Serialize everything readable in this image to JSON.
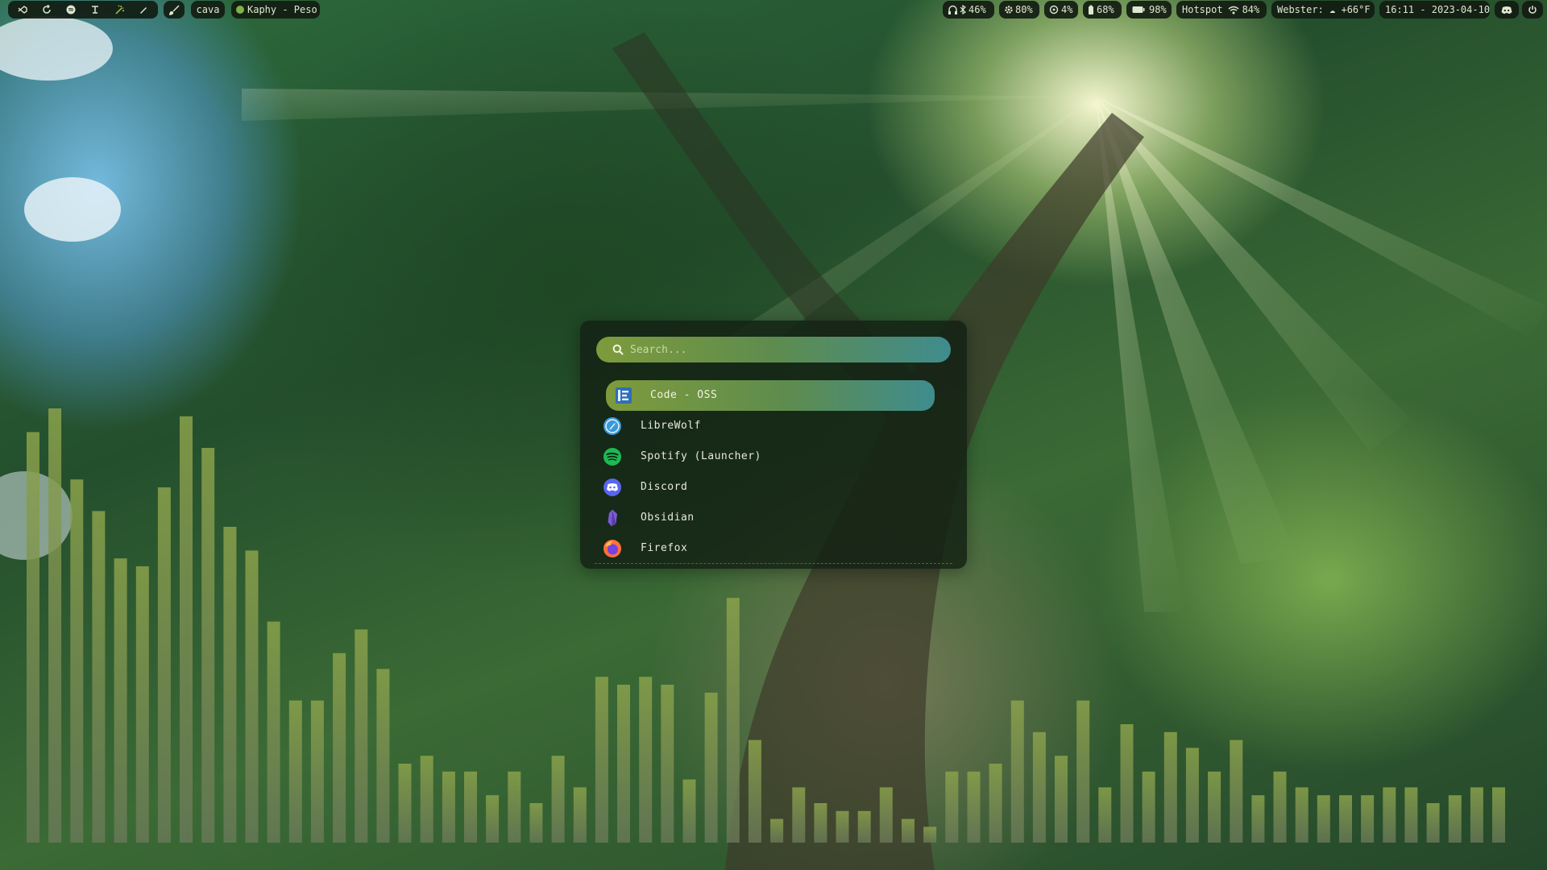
{
  "topbar": {
    "left": {
      "workspaces": [
        {
          "icon": "vscode-icon",
          "active": false
        },
        {
          "icon": "refresh-icon",
          "active": false
        },
        {
          "icon": "spotify-icon",
          "active": false
        },
        {
          "icon": "pin-icon",
          "active": false
        },
        {
          "icon": "wand-icon",
          "active": true
        },
        {
          "icon": "pen-icon",
          "active": false
        }
      ],
      "brush_icon": "brush-icon",
      "cava_label": "cava",
      "now_playing": "Kaphy - Peso"
    },
    "right": {
      "headphones": "46%",
      "cpu": "80%",
      "disk": "4%",
      "battery_device": "68%",
      "battery": "98%",
      "network_name": "Hotspot",
      "wifi": "84%",
      "weather": "Webster: ☁ +66°F",
      "clock": "16:11 - 2023-04-10"
    }
  },
  "launcher": {
    "search_placeholder": "Search...",
    "apps": [
      {
        "label": "Code - OSS",
        "icon": "code-oss-icon",
        "selected": true
      },
      {
        "label": "LibreWolf",
        "icon": "librewolf-icon",
        "selected": false
      },
      {
        "label": "Spotify (Launcher)",
        "icon": "spotify-icon",
        "selected": false
      },
      {
        "label": "Discord",
        "icon": "discord-icon",
        "selected": false
      },
      {
        "label": "Obsidian",
        "icon": "obsidian-icon",
        "selected": false
      },
      {
        "label": "Firefox",
        "icon": "firefox-icon",
        "selected": false
      }
    ]
  },
  "visualizer": {
    "levels": [
      0.52,
      0.55,
      0.46,
      0.42,
      0.36,
      0.35,
      0.45,
      0.54,
      0.5,
      0.4,
      0.37,
      0.28,
      0.18,
      0.18,
      0.24,
      0.27,
      0.22,
      0.1,
      0.11,
      0.09,
      0.09,
      0.06,
      0.09,
      0.05,
      0.11,
      0.07,
      0.21,
      0.2,
      0.21,
      0.2,
      0.08,
      0.19,
      0.31,
      0.13,
      0.03,
      0.07,
      0.05,
      0.04,
      0.04,
      0.07,
      0.03,
      0.02,
      0.09,
      0.09,
      0.1,
      0.18,
      0.14,
      0.11,
      0.18,
      0.07,
      0.15,
      0.09,
      0.14,
      0.12,
      0.09,
      0.13,
      0.06,
      0.09,
      0.07,
      0.06,
      0.06,
      0.06,
      0.07,
      0.07,
      0.05,
      0.06,
      0.07,
      0.07
    ],
    "colors": {
      "top": "#8aa24a",
      "bottom": "#6b7a5a"
    }
  },
  "colors": {
    "accent": "#7e9b3c",
    "accent2": "#3f8c8e",
    "panel": "#14221a",
    "text": "#e6ead8"
  }
}
